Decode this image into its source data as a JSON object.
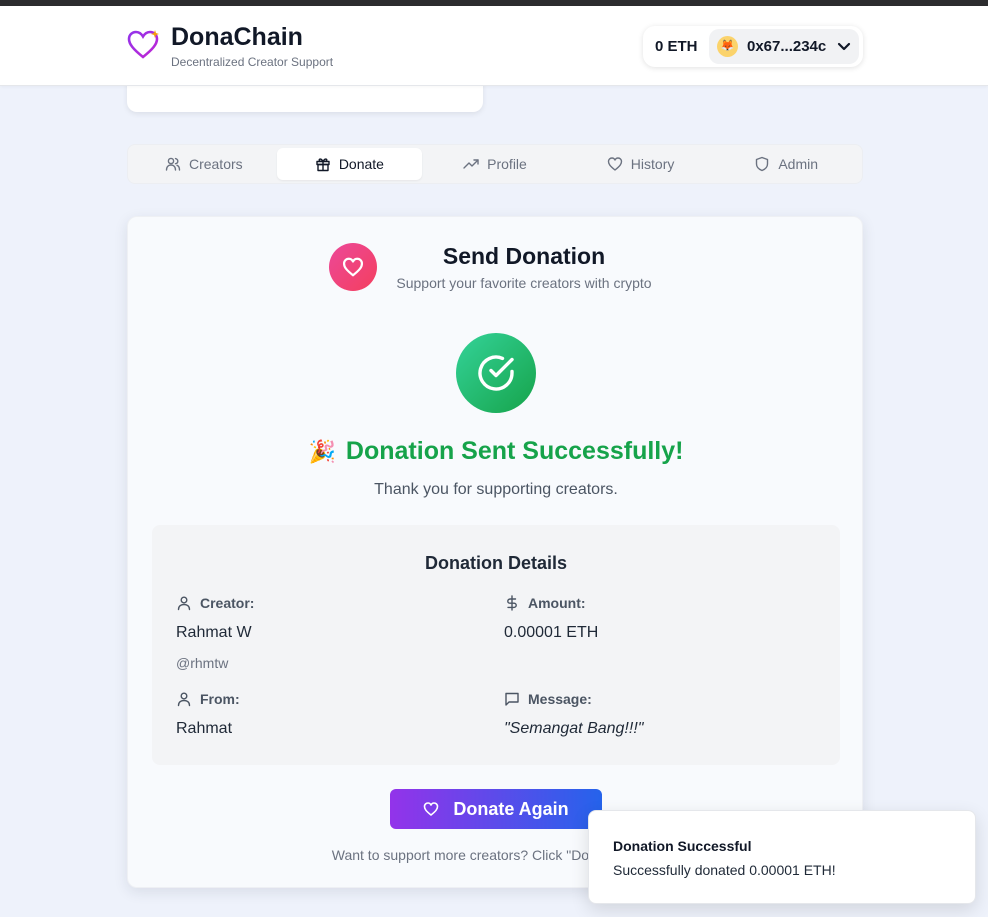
{
  "header": {
    "brand_name": "DonaChain",
    "brand_tagline": "Decentralized Creator Support",
    "eth_balance": "0 ETH",
    "wallet_address": "0x67...234c"
  },
  "tabs": [
    {
      "label": "Creators",
      "icon": "users-icon",
      "active": false
    },
    {
      "label": "Donate",
      "icon": "gift-icon",
      "active": true
    },
    {
      "label": "Profile",
      "icon": "trending-up-icon",
      "active": false
    },
    {
      "label": "History",
      "icon": "heart-icon",
      "active": false
    },
    {
      "label": "Admin",
      "icon": "shield-icon",
      "active": false
    }
  ],
  "card": {
    "title": "Send Donation",
    "subtitle": "Support your favorite creators with crypto",
    "success_title": "Donation Sent Successfully!",
    "success_emoji": "🎉",
    "success_message": "Thank you for supporting creators.",
    "details": {
      "title": "Donation Details",
      "creator_label": "Creator:",
      "creator_name": "Rahmat W",
      "creator_handle": "@rhmtw",
      "amount_label": "Amount:",
      "amount_value": "0.00001 ETH",
      "from_label": "From:",
      "from_value": "Rahmat",
      "message_label": "Message:",
      "message_value": "\"Semangat Bang!!!\""
    },
    "donate_again_label": "Donate Again",
    "bottom_note": "Want to support more creators? Click \"Donate Again\""
  },
  "toast": {
    "title": "Donation Successful",
    "body": "Successfully donated 0.00001 ETH!"
  },
  "colors": {
    "accent_purple": "#9333ea",
    "accent_blue": "#2563eb",
    "success_green": "#16a34a",
    "heart_pink": "#ec4899"
  }
}
